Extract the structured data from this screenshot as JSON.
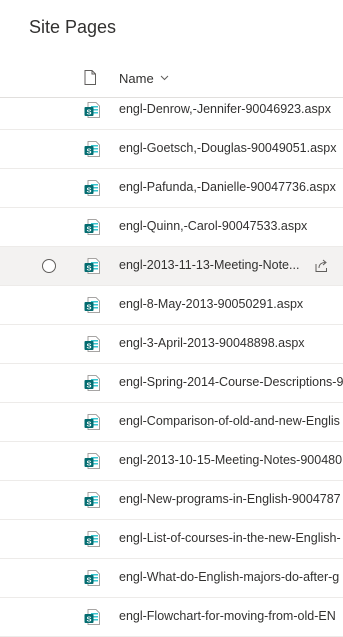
{
  "page": {
    "title": "Site Pages"
  },
  "list": {
    "header": {
      "name_label": "Name"
    },
    "items": [
      {
        "name": "engl-Denrow,-Jennifer-90046923.aspx"
      },
      {
        "name": "engl-Goetsch,-Douglas-90049051.aspx"
      },
      {
        "name": "engl-Pafunda,-Danielle-90047736.aspx"
      },
      {
        "name": "engl-Quinn,-Carol-90047533.aspx"
      },
      {
        "name": "engl-2013-11-13-Meeting-Note...",
        "selected": true
      },
      {
        "name": "engl-8-May-2013-90050291.aspx"
      },
      {
        "name": "engl-3-April-2013-90048898.aspx"
      },
      {
        "name": "engl-Spring-2014-Course-Descriptions-9"
      },
      {
        "name": "engl-Comparison-of-old-and-new-Englis"
      },
      {
        "name": "engl-2013-10-15-Meeting-Notes-900480"
      },
      {
        "name": "engl-New-programs-in-English-9004787"
      },
      {
        "name": "engl-List-of-courses-in-the-new-English-"
      },
      {
        "name": "engl-What-do-English-majors-do-after-g"
      },
      {
        "name": "engl-Flowchart-for-moving-from-old-EN"
      }
    ]
  },
  "icons": {
    "file_header": "document-icon",
    "sort": "chevron-down-icon",
    "page": "sharepoint-page-icon",
    "share": "share-icon"
  },
  "colors": {
    "page_icon": "#036c70",
    "page_icon_light": "#37c6d0",
    "selected_row": "#f3f2f1"
  }
}
